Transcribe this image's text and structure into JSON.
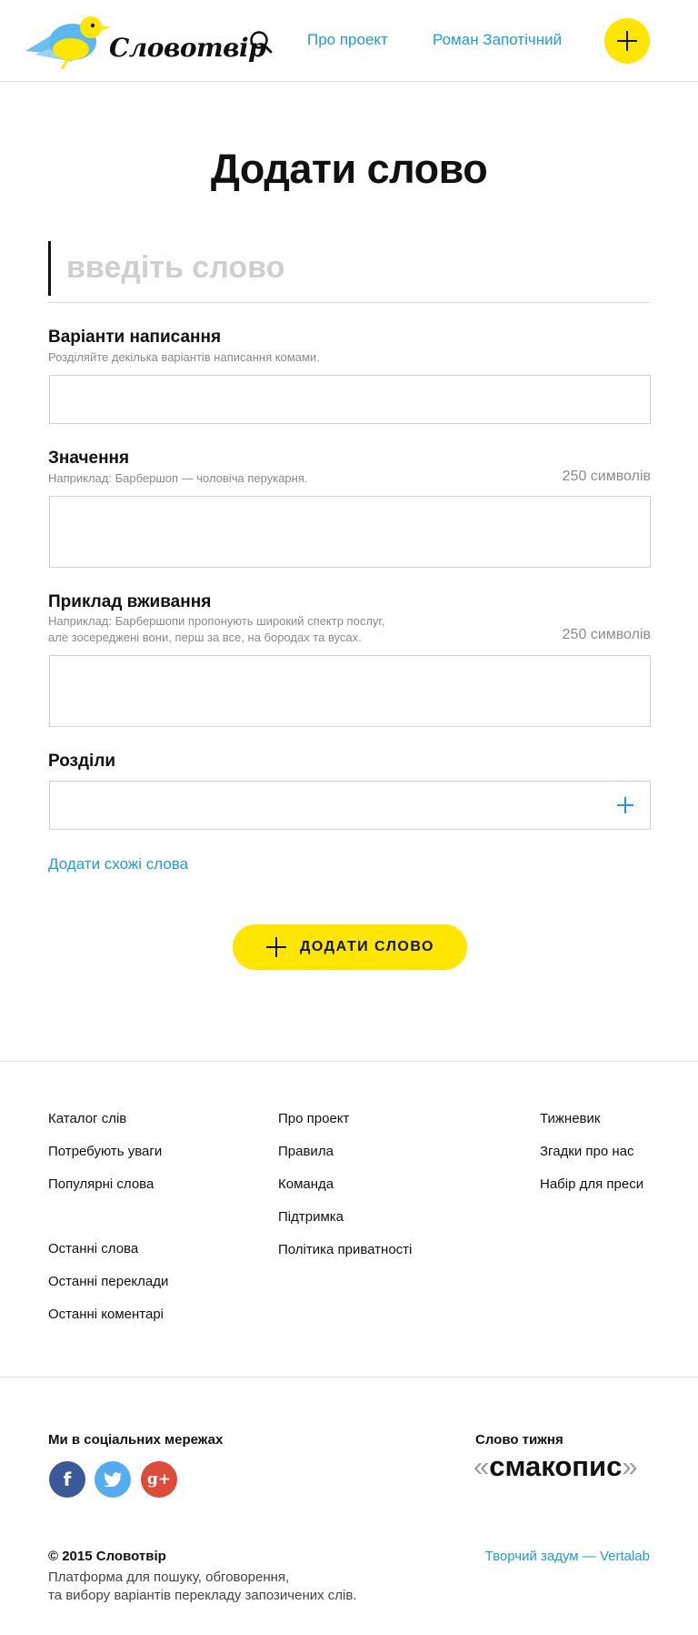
{
  "header": {
    "logo_text": "Словотвір",
    "nav": {
      "about": "Про проект",
      "user": "Роман Запотічний"
    }
  },
  "form": {
    "title": "Додати слово",
    "word_placeholder": "введіть слово",
    "spellings": {
      "label": "Варіанти написання",
      "hint": "Розділяйте декілька варіантів написання комами."
    },
    "meaning": {
      "label": "Значення",
      "hint": "Наприклад: Барбершоп — чоловіча перукарня.",
      "counter": "250 символів"
    },
    "example": {
      "label": "Приклад вживання",
      "hint_line1": "Наприклад: Барбершопи пропонують широкий спектр послуг,",
      "hint_line2": "але зосереджені вони, перш за все, на бородах та вусах.",
      "counter": "250 символів"
    },
    "sections": {
      "label": "Розділи"
    },
    "similar_link": "Додати схожі слова",
    "submit": "ДОДАТИ СЛОВО"
  },
  "footer": {
    "col1_group1": [
      "Каталог слів",
      "Потребують уваги",
      "Популярні слова"
    ],
    "col1_group2": [
      "Останні слова",
      "Останні переклади",
      "Останні коментарі"
    ],
    "col2": [
      "Про проект",
      "Правила",
      "Команда",
      "Підтримка",
      "Політика приватності"
    ],
    "col3": [
      "Тижневик",
      "Згадки про нас",
      "Набір для преси"
    ],
    "social_title": "Ми в соціальних мережах",
    "social": {
      "facebook": "f",
      "twitter": "t",
      "google": "g+"
    },
    "word_of_week_title": "Слово тижня",
    "word_of_week": "смакопис",
    "copyright": "© 2015 Словотвір",
    "platform_line1": "Платформа для пошуку, обговорення,",
    "platform_line2": "та вибору варіантів перекладу запозичених слів.",
    "credit": "Творчий задум — Vertalab"
  },
  "colors": {
    "accent_yellow": "#ffe600",
    "link_blue": "#1d9be0",
    "facebook": "#3b5998",
    "twitter": "#55acee",
    "google": "#dd4b39"
  },
  "icons": [
    "bird-logo-icon",
    "search-icon",
    "plus-icon",
    "facebook-icon",
    "twitter-icon",
    "google-plus-icon"
  ]
}
